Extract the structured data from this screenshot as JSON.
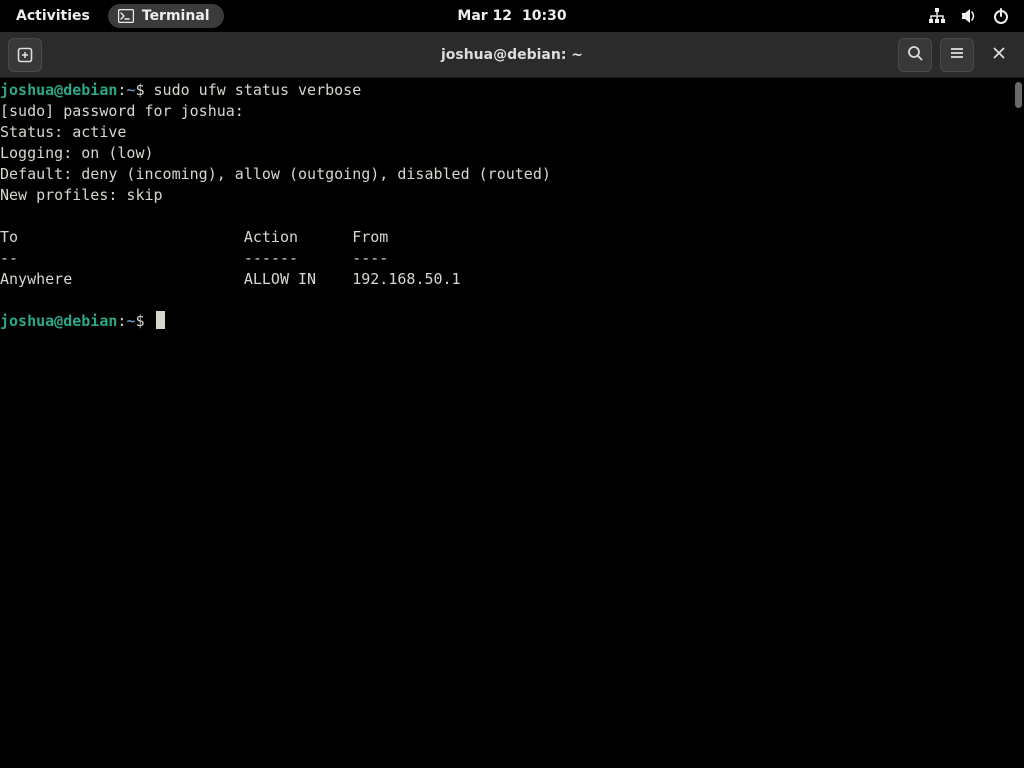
{
  "topbar": {
    "activities": "Activities",
    "app_name": "Terminal",
    "date": "Mar 12",
    "time": "10:30"
  },
  "window": {
    "title": "joshua@debian: ~"
  },
  "prompt": {
    "user_host": "joshua@debian",
    "separator": ":",
    "path": "~",
    "symbol": "$"
  },
  "session": {
    "command1": "sudo ufw status verbose",
    "lines": [
      "[sudo] password for joshua: ",
      "Status: active",
      "Logging: on (low)",
      "Default: deny (incoming), allow (outgoing), disabled (routed)",
      "New profiles: skip",
      "",
      "To                         Action      From",
      "--                         ------      ----",
      "Anywhere                   ALLOW IN    192.168.50.1              ",
      ""
    ]
  }
}
